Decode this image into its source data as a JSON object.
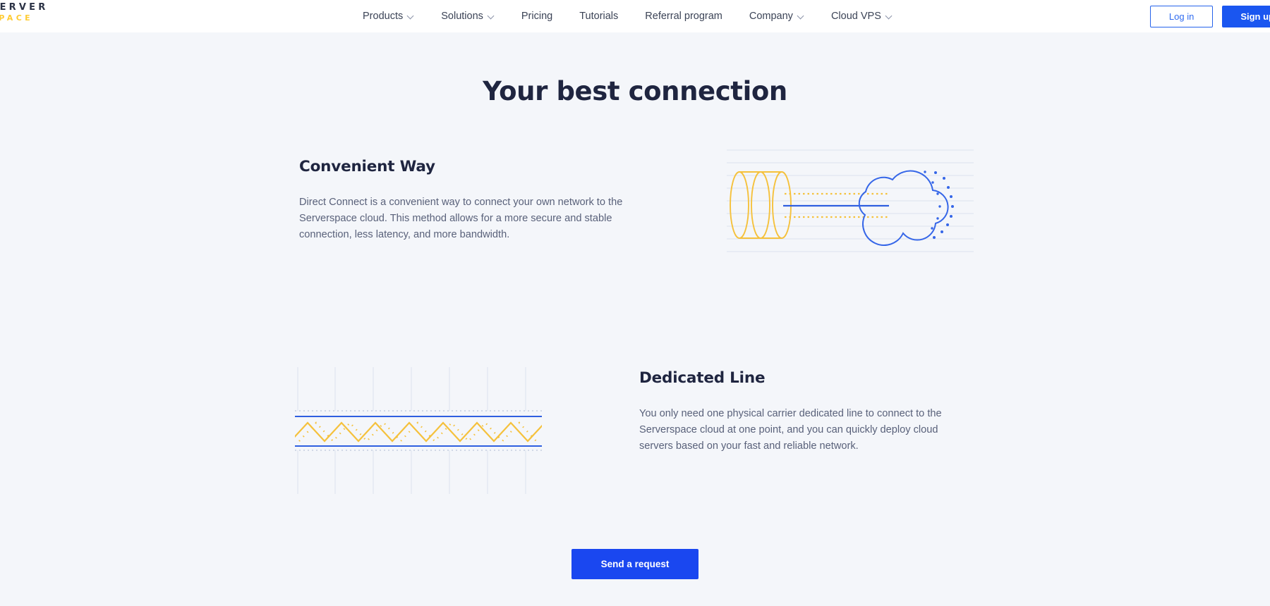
{
  "header": {
    "logo": {
      "line1": "SERVER",
      "line2": "SPACE"
    },
    "nav": [
      {
        "label": "Products",
        "has_caret": true
      },
      {
        "label": "Solutions",
        "has_caret": true
      },
      {
        "label": "Pricing",
        "has_caret": false
      },
      {
        "label": "Tutorials",
        "has_caret": false
      },
      {
        "label": "Referral program",
        "has_caret": false
      },
      {
        "label": "Company",
        "has_caret": true
      },
      {
        "label": "Cloud VPS",
        "has_caret": true
      }
    ],
    "login_label": "Log in",
    "signup_label": "Sign up"
  },
  "main": {
    "title": "Your best connection",
    "blocks": [
      {
        "heading": "Convenient Way",
        "body": "Direct Connect is a convenient way to connect your own network to the Serverspace cloud. This method allows for a more secure and stable connection, less latency, and more bandwidth.",
        "art": "cloud-tunnel-illustration"
      },
      {
        "heading": "Dedicated Line",
        "body": "You only need one physical carrier dedicated line to connect to the Serverspace cloud at one point, and you can quickly deploy cloud servers based on your fast and reliable network.",
        "art": "zigzag-signal-illustration"
      }
    ],
    "cta_label": "Send a request"
  },
  "colors": {
    "page_background": "#f4f6fa",
    "header_background": "#ffffff",
    "brand_yellow": "#ffcc33",
    "brand_blue": "#1a47f0",
    "accent_blue": "#2563eb",
    "heading_text": "#1f2540",
    "body_text": "#59617a",
    "art_yellow": "#f5c13c",
    "art_blue": "#3566e8",
    "art_grid": "#e4e9f2"
  }
}
